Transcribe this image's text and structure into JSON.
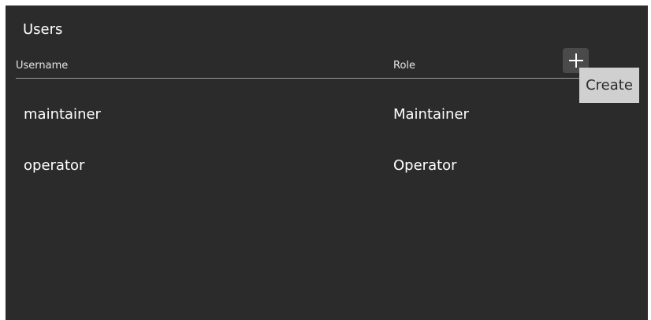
{
  "panel": {
    "title": "Users"
  },
  "table": {
    "columns": {
      "username": "Username",
      "role": "Role"
    },
    "rows": [
      {
        "username": "maintainer",
        "role": "Maintainer"
      },
      {
        "username": "operator",
        "role": "Operator"
      }
    ]
  },
  "actions": {
    "add_icon": "plus-icon",
    "create_tooltip": "Create"
  }
}
